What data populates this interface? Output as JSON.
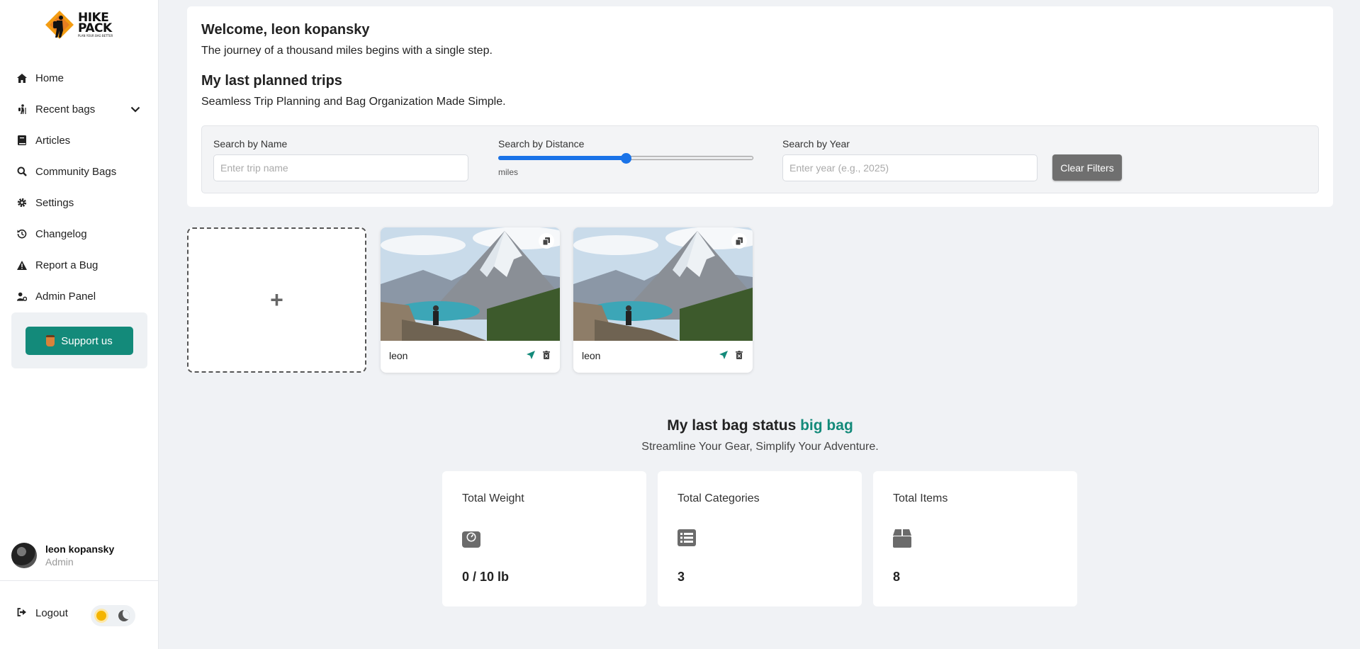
{
  "sidebar": {
    "logo": {
      "line1": "HIKE",
      "line2": "PACK",
      "tagline": "PLAN YOUR BAG BETTER"
    },
    "nav": [
      {
        "label": "Home",
        "icon": "home-icon"
      },
      {
        "label": "Recent bags",
        "icon": "hiking-icon"
      },
      {
        "label": "Articles",
        "icon": "book-icon"
      },
      {
        "label": "Community Bags",
        "icon": "search-icon"
      },
      {
        "label": "Settings",
        "icon": "gear-icon"
      },
      {
        "label": "Changelog",
        "icon": "history-icon"
      },
      {
        "label": "Report a Bug",
        "icon": "warning-icon"
      },
      {
        "label": "Admin Panel",
        "icon": "user-gear-icon"
      }
    ],
    "support_label": "Support us",
    "user": {
      "name": "leon kopansky",
      "role": "Admin"
    },
    "logout_label": "Logout"
  },
  "header": {
    "welcome": "Welcome, leon kopansky",
    "tagline": "The journey of a thousand miles begins with a single step.",
    "trips_title": "My last planned trips",
    "trips_subtitle": "Seamless Trip Planning and Bag Organization Made Simple."
  },
  "filters": {
    "name_label": "Search by Name",
    "name_placeholder": "Enter trip name",
    "distance_label": "Search by Distance",
    "distance_value_fraction": 0.5,
    "distance_unit": "miles",
    "year_label": "Search by Year",
    "year_placeholder": "Enter year (e.g., 2025)",
    "clear_label": "Clear Filters"
  },
  "trips": [
    {
      "name": "leon"
    },
    {
      "name": "leon"
    }
  ],
  "bag_status": {
    "title_prefix": "My last bag status",
    "bag_name": "big bag",
    "subtitle": "Streamline Your Gear, Simplify Your Adventure.",
    "stats": [
      {
        "label": "Total Weight",
        "value": "0 / 10 lb",
        "icon": "weight-scale-icon"
      },
      {
        "label": "Total Categories",
        "value": "3",
        "icon": "list-icon"
      },
      {
        "label": "Total Items",
        "value": "8",
        "icon": "box-icon"
      }
    ]
  },
  "colors": {
    "accent": "#138a7a",
    "slider": "#1a73e8",
    "background": "#f0f2f5"
  }
}
